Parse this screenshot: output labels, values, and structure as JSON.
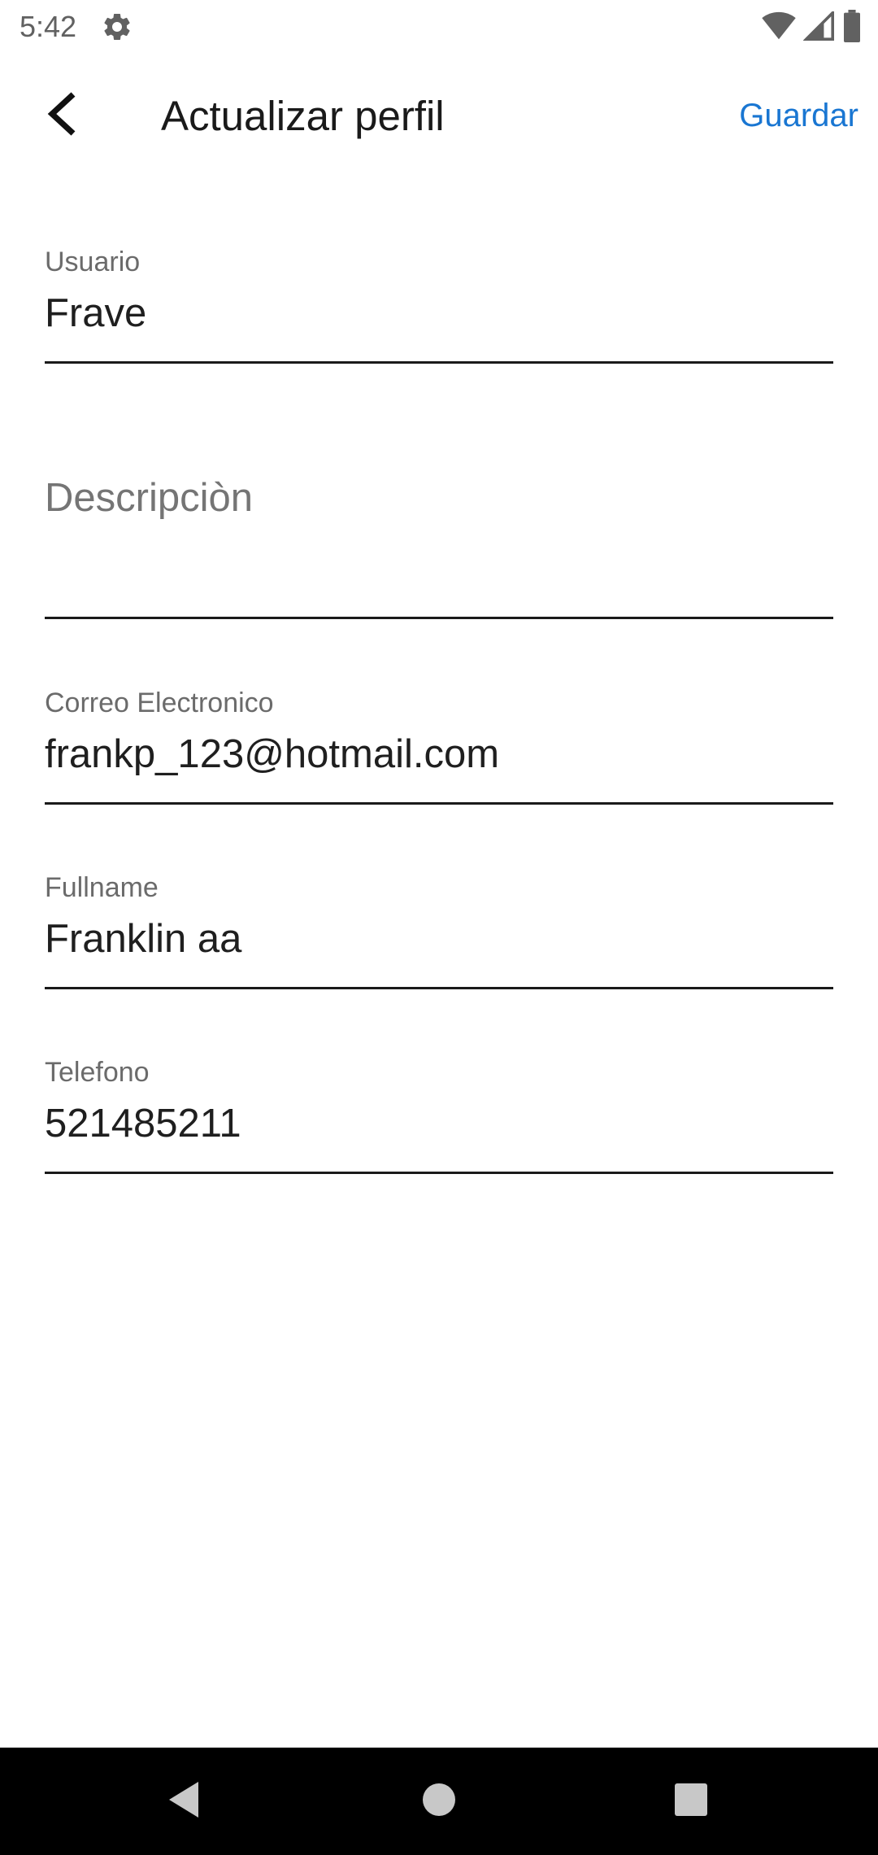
{
  "status_bar": {
    "time": "5:42",
    "icons": [
      "gear-icon",
      "wifi-icon",
      "signal-icon",
      "battery-icon"
    ]
  },
  "app_bar": {
    "title": "Actualizar perfil",
    "save_label": "Guardar",
    "back_icon": "chevron-left-icon"
  },
  "form": {
    "username": {
      "label": "Usuario",
      "value": "Frave"
    },
    "description": {
      "placeholder": "Descripciòn",
      "value": ""
    },
    "email": {
      "label": "Correo Electronico",
      "value": "frankp_123@hotmail.com"
    },
    "fullname": {
      "label": "Fullname",
      "value": "Franklin aa"
    },
    "phone": {
      "label": "Telefono",
      "value": "521485211"
    }
  },
  "nav_bar": {
    "icons": [
      "back-triangle-icon",
      "home-circle-icon",
      "recents-square-icon"
    ]
  },
  "colors": {
    "accent": "#1976d2",
    "text": "#1f1f1f",
    "label": "#6b6b6b",
    "nav_bg": "#000000"
  }
}
